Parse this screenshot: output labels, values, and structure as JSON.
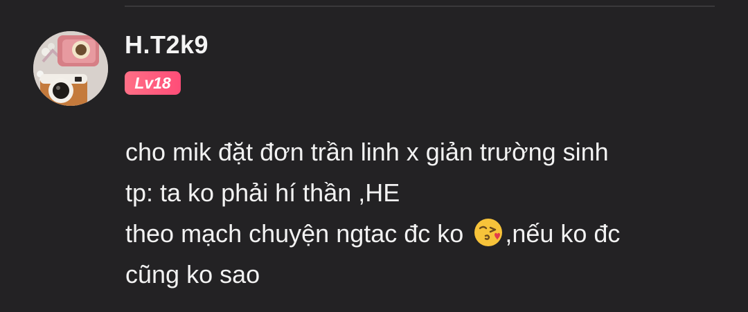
{
  "comment": {
    "username": "H.T2k9",
    "level_badge": "Lv18",
    "avatar_icon": "crochet-camera-avatar",
    "body": {
      "line1": "cho mik đặt đơn trần linh x giản trường sinh",
      "line2": "tp: ta ko phải hí thần ,HE",
      "line3_before_emoji": "theo mạch chuyện ngtac đc ko ",
      "emoji": "face-blowing-a-kiss-icon",
      "line3_after_emoji": ",nếu ko đc",
      "line4": "cũng ko sao"
    }
  },
  "colors": {
    "background": "#232224",
    "badge": "#ff5a7a",
    "text": "#f2f2f2"
  }
}
